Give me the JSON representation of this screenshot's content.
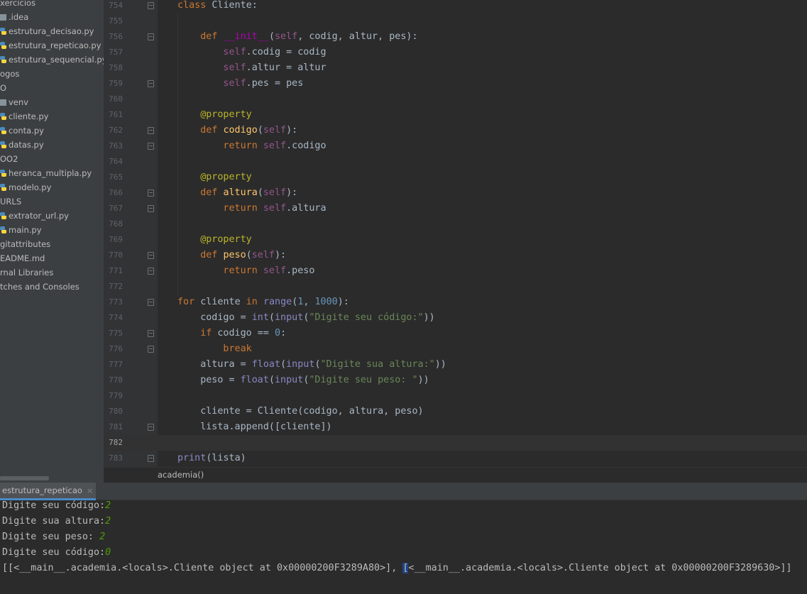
{
  "sidebar": {
    "items": [
      {
        "label": "xercicios",
        "icon": "none"
      },
      {
        "label": ".idea",
        "icon": "folder-icon"
      },
      {
        "label": "estrutura_decisao.py",
        "icon": "python-file-icon"
      },
      {
        "label": "estrutura_repeticao.py",
        "icon": "python-file-icon"
      },
      {
        "label": "estrutura_sequencial.py",
        "icon": "python-file-icon"
      },
      {
        "label": "ogos",
        "icon": "none"
      },
      {
        "label": "O",
        "icon": "none"
      },
      {
        "label": "venv",
        "icon": "folder-icon"
      },
      {
        "label": "cliente.py",
        "icon": "python-file-icon"
      },
      {
        "label": "conta.py",
        "icon": "python-file-icon"
      },
      {
        "label": "datas.py",
        "icon": "python-file-icon"
      },
      {
        "label": "OO2",
        "icon": "none"
      },
      {
        "label": "heranca_multipla.py",
        "icon": "python-file-icon"
      },
      {
        "label": "modelo.py",
        "icon": "python-file-icon"
      },
      {
        "label": "URLS",
        "icon": "none"
      },
      {
        "label": "extrator_url.py",
        "icon": "python-file-icon"
      },
      {
        "label": "main.py",
        "icon": "python-file-icon"
      },
      {
        "label": "gitattributes",
        "icon": "none"
      },
      {
        "label": "EADME.md",
        "icon": "none"
      },
      {
        "label": "rnal Libraries",
        "icon": "none"
      },
      {
        "label": "tches and Consoles",
        "icon": "none"
      }
    ]
  },
  "editor": {
    "current_line": "782",
    "lines": [
      {
        "n": "754",
        "fold": true,
        "indent": 0,
        "tokens": [
          [
            "kw",
            "class "
          ],
          [
            "p",
            "Cliente:"
          ]
        ]
      },
      {
        "n": "755",
        "fold": false,
        "indent": 0,
        "tokens": []
      },
      {
        "n": "756",
        "fold": true,
        "indent": 1,
        "tokens": [
          [
            "kw",
            "def "
          ],
          [
            "magic",
            "__init__"
          ],
          [
            "p",
            "("
          ],
          [
            "self",
            "self"
          ],
          [
            "p",
            ", codig, altur, pes):"
          ]
        ]
      },
      {
        "n": "757",
        "fold": false,
        "indent": 2,
        "tokens": [
          [
            "self",
            "self"
          ],
          [
            "p",
            ".codig = codig"
          ]
        ]
      },
      {
        "n": "758",
        "fold": false,
        "indent": 2,
        "tokens": [
          [
            "self",
            "self"
          ],
          [
            "p",
            ".altur = altur"
          ]
        ]
      },
      {
        "n": "759",
        "fold": true,
        "indent": 2,
        "tokens": [
          [
            "self",
            "self"
          ],
          [
            "p",
            ".pes = pes"
          ]
        ]
      },
      {
        "n": "760",
        "fold": false,
        "indent": 0,
        "tokens": []
      },
      {
        "n": "761",
        "fold": false,
        "indent": 1,
        "tokens": [
          [
            "deco",
            "@property"
          ]
        ]
      },
      {
        "n": "762",
        "fold": true,
        "indent": 1,
        "tokens": [
          [
            "kw",
            "def "
          ],
          [
            "fn",
            "codigo"
          ],
          [
            "p",
            "("
          ],
          [
            "self",
            "self"
          ],
          [
            "p",
            "):"
          ]
        ]
      },
      {
        "n": "763",
        "fold": true,
        "indent": 2,
        "tokens": [
          [
            "kw",
            "return "
          ],
          [
            "self",
            "self"
          ],
          [
            "p",
            ".codigo"
          ]
        ]
      },
      {
        "n": "764",
        "fold": false,
        "indent": 0,
        "tokens": []
      },
      {
        "n": "765",
        "fold": false,
        "indent": 1,
        "tokens": [
          [
            "deco",
            "@property"
          ]
        ]
      },
      {
        "n": "766",
        "fold": true,
        "indent": 1,
        "tokens": [
          [
            "kw",
            "def "
          ],
          [
            "fn",
            "altura"
          ],
          [
            "p",
            "("
          ],
          [
            "self",
            "self"
          ],
          [
            "p",
            "):"
          ]
        ]
      },
      {
        "n": "767",
        "fold": true,
        "indent": 2,
        "tokens": [
          [
            "kw",
            "return "
          ],
          [
            "self",
            "self"
          ],
          [
            "p",
            ".altura"
          ]
        ]
      },
      {
        "n": "768",
        "fold": false,
        "indent": 0,
        "tokens": []
      },
      {
        "n": "769",
        "fold": false,
        "indent": 1,
        "tokens": [
          [
            "deco",
            "@property"
          ]
        ]
      },
      {
        "n": "770",
        "fold": true,
        "indent": 1,
        "tokens": [
          [
            "kw",
            "def "
          ],
          [
            "fn",
            "peso"
          ],
          [
            "p",
            "("
          ],
          [
            "self",
            "self"
          ],
          [
            "p",
            "):"
          ]
        ]
      },
      {
        "n": "771",
        "fold": true,
        "indent": 2,
        "tokens": [
          [
            "kw",
            "return "
          ],
          [
            "self",
            "self"
          ],
          [
            "p",
            ".peso"
          ]
        ]
      },
      {
        "n": "772",
        "fold": false,
        "indent": 0,
        "tokens": []
      },
      {
        "n": "773",
        "fold": true,
        "indent": 0,
        "tokens": [
          [
            "kw",
            "for "
          ],
          [
            "p",
            "cliente "
          ],
          [
            "kw",
            "in "
          ],
          [
            "bi",
            "range"
          ],
          [
            "p",
            "("
          ],
          [
            "num",
            "1"
          ],
          [
            "p",
            ", "
          ],
          [
            "num",
            "1000"
          ],
          [
            "p",
            "):"
          ]
        ]
      },
      {
        "n": "774",
        "fold": false,
        "indent": 1,
        "tokens": [
          [
            "p",
            "codigo = "
          ],
          [
            "bi",
            "int"
          ],
          [
            "p",
            "("
          ],
          [
            "bi",
            "input"
          ],
          [
            "p",
            "("
          ],
          [
            "str",
            "\"Digite seu código:\""
          ],
          [
            "p",
            "))"
          ]
        ]
      },
      {
        "n": "775",
        "fold": true,
        "indent": 1,
        "tokens": [
          [
            "kw",
            "if "
          ],
          [
            "p",
            "codigo == "
          ],
          [
            "num",
            "0"
          ],
          [
            "p",
            ":"
          ]
        ]
      },
      {
        "n": "776",
        "fold": true,
        "indent": 2,
        "tokens": [
          [
            "kw",
            "break"
          ]
        ]
      },
      {
        "n": "777",
        "fold": false,
        "indent": 1,
        "tokens": [
          [
            "p",
            "altura = "
          ],
          [
            "bi",
            "float"
          ],
          [
            "p",
            "("
          ],
          [
            "bi",
            "input"
          ],
          [
            "p",
            "("
          ],
          [
            "str",
            "\"Digite sua altura:\""
          ],
          [
            "p",
            "))"
          ]
        ]
      },
      {
        "n": "778",
        "fold": false,
        "indent": 1,
        "tokens": [
          [
            "p",
            "peso = "
          ],
          [
            "bi",
            "float"
          ],
          [
            "p",
            "("
          ],
          [
            "bi",
            "input"
          ],
          [
            "p",
            "("
          ],
          [
            "str",
            "\"Digite seu peso: \""
          ],
          [
            "p",
            "))"
          ]
        ]
      },
      {
        "n": "779",
        "fold": false,
        "indent": 0,
        "tokens": []
      },
      {
        "n": "780",
        "fold": false,
        "indent": 1,
        "tokens": [
          [
            "p",
            "cliente = Cliente(codigo, altura, peso)"
          ]
        ]
      },
      {
        "n": "781",
        "fold": true,
        "indent": 1,
        "tokens": [
          [
            "p",
            "lista.append([cliente])"
          ]
        ]
      },
      {
        "n": "782",
        "fold": false,
        "indent": 0,
        "tokens": []
      },
      {
        "n": "783",
        "fold": true,
        "indent": 0,
        "tokens": [
          [
            "bi",
            "print"
          ],
          [
            "p",
            "(lista)"
          ]
        ]
      }
    ]
  },
  "breadcrumb": {
    "label": "academia()"
  },
  "run_panel": {
    "tab_label": "estrutura_repeticao",
    "close_glyph": "×"
  },
  "console": {
    "lines": [
      {
        "prompt": "Digite seu código:",
        "input": "2",
        "style": "green"
      },
      {
        "prompt": "Digite sua altura:",
        "input": "2",
        "style": "green"
      },
      {
        "prompt": "Digite seu peso: ",
        "input": "2",
        "style": "green"
      },
      {
        "prompt": "Digite seu código:",
        "input": "0",
        "style": "green"
      }
    ],
    "output_part1": "[[<__main__.academia.<locals>.Cliente object at 0x00000200F3289A80>], ",
    "output_bracket": "[",
    "output_part2": "<__main__.academia.<locals>.Cliente object at 0x00000200F3289630>]]"
  },
  "colors": {
    "keyword": "#cc7832",
    "function": "#ffc66d",
    "self": "#94558d",
    "number": "#6897bb",
    "string": "#6a8759",
    "decorator": "#bbb529",
    "builtin": "#8888c6"
  }
}
